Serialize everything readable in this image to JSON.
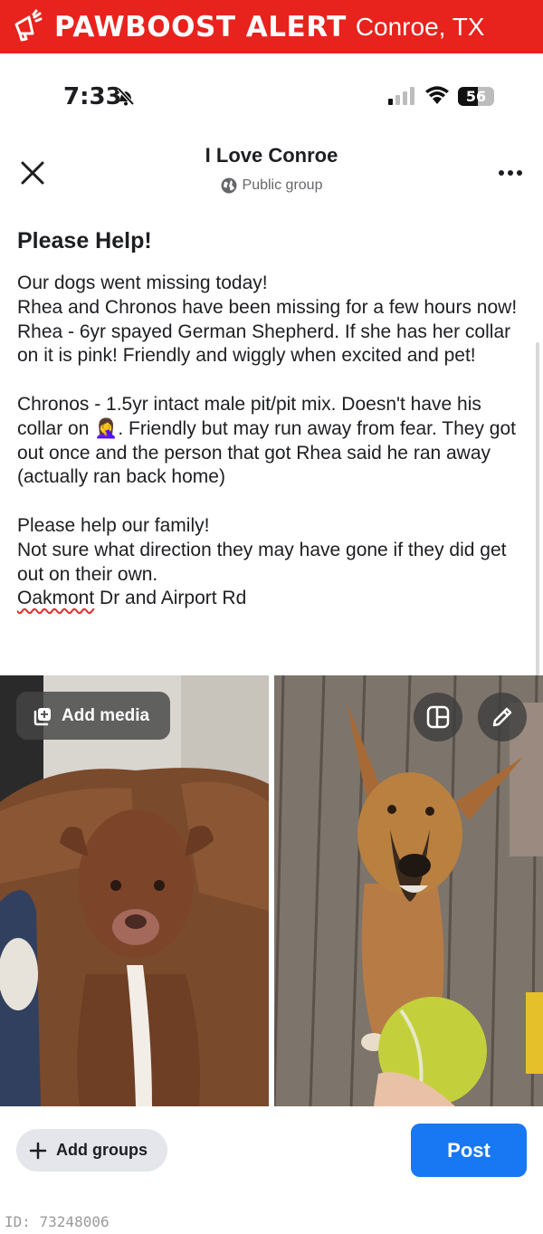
{
  "alert_banner": {
    "brand": "PAWBOOST ALERT",
    "location": "Conroe, TX",
    "color": "#e8221c"
  },
  "status_bar": {
    "time": "7:33",
    "battery_level": "56",
    "icons": [
      "bell-slash-icon",
      "cellular-signal-icon",
      "wifi-icon",
      "battery-icon"
    ]
  },
  "header": {
    "title": "I Love Conroe",
    "subtitle": "Public group",
    "icons": [
      "close-icon",
      "globe-icon",
      "more-icon"
    ]
  },
  "post": {
    "heading": "Please Help!",
    "lines": [
      "Our dogs went missing today!",
      "Rhea and Chronos have been missing for a few hours now!",
      "Rhea - 6yr spayed German Shepherd. If she has her collar on it is pink! Friendly and wiggly when excited and pet!",
      "Chronos - 1.5yr intact male pit/pit mix. Doesn't have his collar on 🤦‍♀️. Friendly but may run away from fear. They got out once and the person that got Rhea said he ran away (actually ran back home)",
      "Please help our family!",
      "Not sure what direction they may have gone if they did get out on their own."
    ],
    "location_street": "Oakmont",
    "location_rest": " Dr and Airport Rd"
  },
  "photos": {
    "add_media_label": "Add media",
    "icons": [
      "add-media-icon",
      "layout-icon",
      "edit-pencil-icon"
    ]
  },
  "footer": {
    "add_groups_label": "Add groups",
    "post_label": "Post",
    "post_color": "#1877f2"
  },
  "image_id": "ID: 73248006"
}
